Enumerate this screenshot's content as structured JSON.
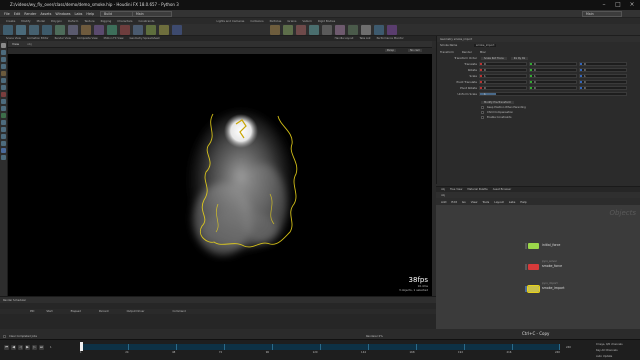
{
  "window": {
    "title": "Z:/videos/wy_fly_over/class/demo/demo_smoke.hip - Houdini FX 18.0.657 - Python 3"
  },
  "menu": {
    "items": [
      "File",
      "Edit",
      "Render",
      "Assets",
      "Windows",
      "Labs",
      "Help",
      "Help"
    ],
    "build_label": "Build",
    "main_label": "Main",
    "right_label": "Main"
  },
  "shelf": {
    "tabs": [
      "Create",
      "Modify",
      "Model",
      "Polygon",
      "Deform",
      "Texture",
      "Rigging",
      "Characters",
      "Constraints",
      "Hair Utils",
      "Guide Process"
    ],
    "right_tabs": [
      "Lights and Cameras",
      "Collisions",
      "Particles",
      "Grains",
      "Vellum",
      "Rigid Bodies",
      "Particle Fluids",
      "Viscous Fluids",
      "Oceans"
    ]
  },
  "pane_tabs": {
    "left": [
      "Scene View",
      "Animation Editor",
      "Render View",
      "Composite View",
      "Motion FX View",
      "Geometry Spreadsheet"
    ],
    "right": [
      "Handle Layout",
      "Take List",
      "Performance Monitor"
    ]
  },
  "viewport": {
    "tab_label": "View",
    "path": "obj",
    "persp_label": "Persp",
    "cam_label": "No cam",
    "fps": "38fps",
    "fps_detail": "10.4ms",
    "selection": "3 objects, 1 selected"
  },
  "params": {
    "header": "Geometry  smoke_import",
    "name_label": "Smoke Name",
    "name_value": "smoke_import",
    "tabs": [
      "Transform",
      "Render",
      "Misc"
    ],
    "transform_order_label": "Transform Order",
    "transform_order_value": "Scale Rot Trans",
    "rot_order_value": "Rx Ry Rz",
    "rows": [
      {
        "label": "Translate",
        "values": [
          "0",
          "0",
          "0"
        ]
      },
      {
        "label": "Rotate",
        "values": [
          "0",
          "0",
          "0"
        ]
      },
      {
        "label": "Scale",
        "values": [
          "1",
          "1",
          "1"
        ]
      },
      {
        "label": "Pivot Translate",
        "values": [
          "0",
          "0",
          "0"
        ]
      },
      {
        "label": "Pivot Rotate",
        "values": [
          "0",
          "0",
          "0"
        ]
      },
      {
        "label": "Uniform Scale",
        "values": [
          "1"
        ]
      }
    ],
    "modify_label": "Modify Pre-Transform",
    "checks": [
      "Keep Position When Parenting",
      "Child Compensation",
      "Enable Constraints"
    ]
  },
  "network": {
    "tabs": [
      "obj",
      "Tree View",
      "Material Palette",
      "Asset Browser"
    ],
    "path": "obj",
    "menu": [
      "Add",
      "Edit",
      "Go",
      "View",
      "Tools",
      "Layout",
      "Labs",
      "Help"
    ],
    "context_label": "Objects",
    "nodes": [
      {
        "name": "initial_force",
        "type": "",
        "color": "#9bd64a"
      },
      {
        "name": "smoke_force",
        "type": "pyro_solver",
        "color": "#d63a3a"
      },
      {
        "name": "smoke_import",
        "type": "pyro_import",
        "color": "#c9c04a"
      }
    ]
  },
  "status": {
    "title": "Render Scheduler",
    "columns": [
      "PID",
      "Start",
      "Elapsed",
      "Percent",
      "Output Driver",
      "Command"
    ],
    "clear_label": "Clear Completed Jobs",
    "render_label": "Renderer 0%"
  },
  "timeline": {
    "ticks": [
      "1",
      "24",
      "48",
      "72",
      "96",
      "120",
      "144",
      "168",
      "192",
      "216",
      "240"
    ],
    "start_frame": "1",
    "current_frame": "1",
    "end_frame": "240",
    "copy_hint": "Ctrl+C - Copy",
    "key_label": "0 keys, 0/0 channels",
    "key_all": "Key All Channels",
    "auto_update": "Auto Update"
  },
  "colors": {
    "accent_blue": "#1f6e96",
    "smoke_outline": "#e8d21a"
  }
}
